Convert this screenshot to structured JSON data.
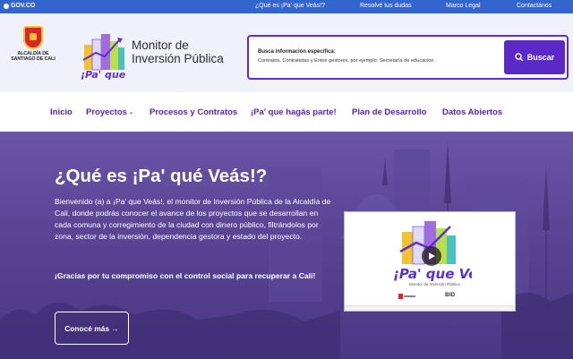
{
  "topbar": {
    "gov_label": "GOV.CO",
    "links": [
      "¿Qué es ¡Pa' que Veás!?",
      "Resolvé tus dudas",
      "Marco Legal",
      "Contactános"
    ],
    "color": "#3366cc"
  },
  "header": {
    "alcaldia_line1": "ALCALDÍA DE",
    "alcaldia_line2": "SANTIAGO DE CALI",
    "logo_text": "¡Pa' que Veás!",
    "title_line1": "Monitor de",
    "title_line2": "Inversión Pública",
    "search": {
      "label": "Busca información específica:",
      "placeholder": "Contratos, Contratistas y Entes gestores, por ejemplo: Secretaría de educación",
      "button": "Buscar"
    },
    "accent": "#5a29c8"
  },
  "nav": {
    "items": [
      "Inicio",
      "Proyectos",
      "Procesos y Contratos",
      "¡Pa' que hagás parte!",
      "Plan de Desarrollo",
      "Datos Abiertos"
    ]
  },
  "hero": {
    "title": "¿Qué es ¡Pa' qué Veás!?",
    "description": "Bienvenido (a) a ¡Pa' que Veás!, el monitor de Inversión Pública de la Alcaldía de Cali, donde podrás conocer el avance de los proyectos que se desarrollan en cada comuna y corregimiento de la ciudad con dinero público, filtrándolos por zona, sector de la inversión, dependencia gestora y estado del proyecto.",
    "cta": "¡Gracias por tu compromiso con el control social para recuperar a Cali!",
    "button": "Conocé más →",
    "video": {
      "logo_text": "¡Pa' que Veás!",
      "subtitle": "Monitor de Inversión Pública",
      "partner": "BID"
    }
  }
}
